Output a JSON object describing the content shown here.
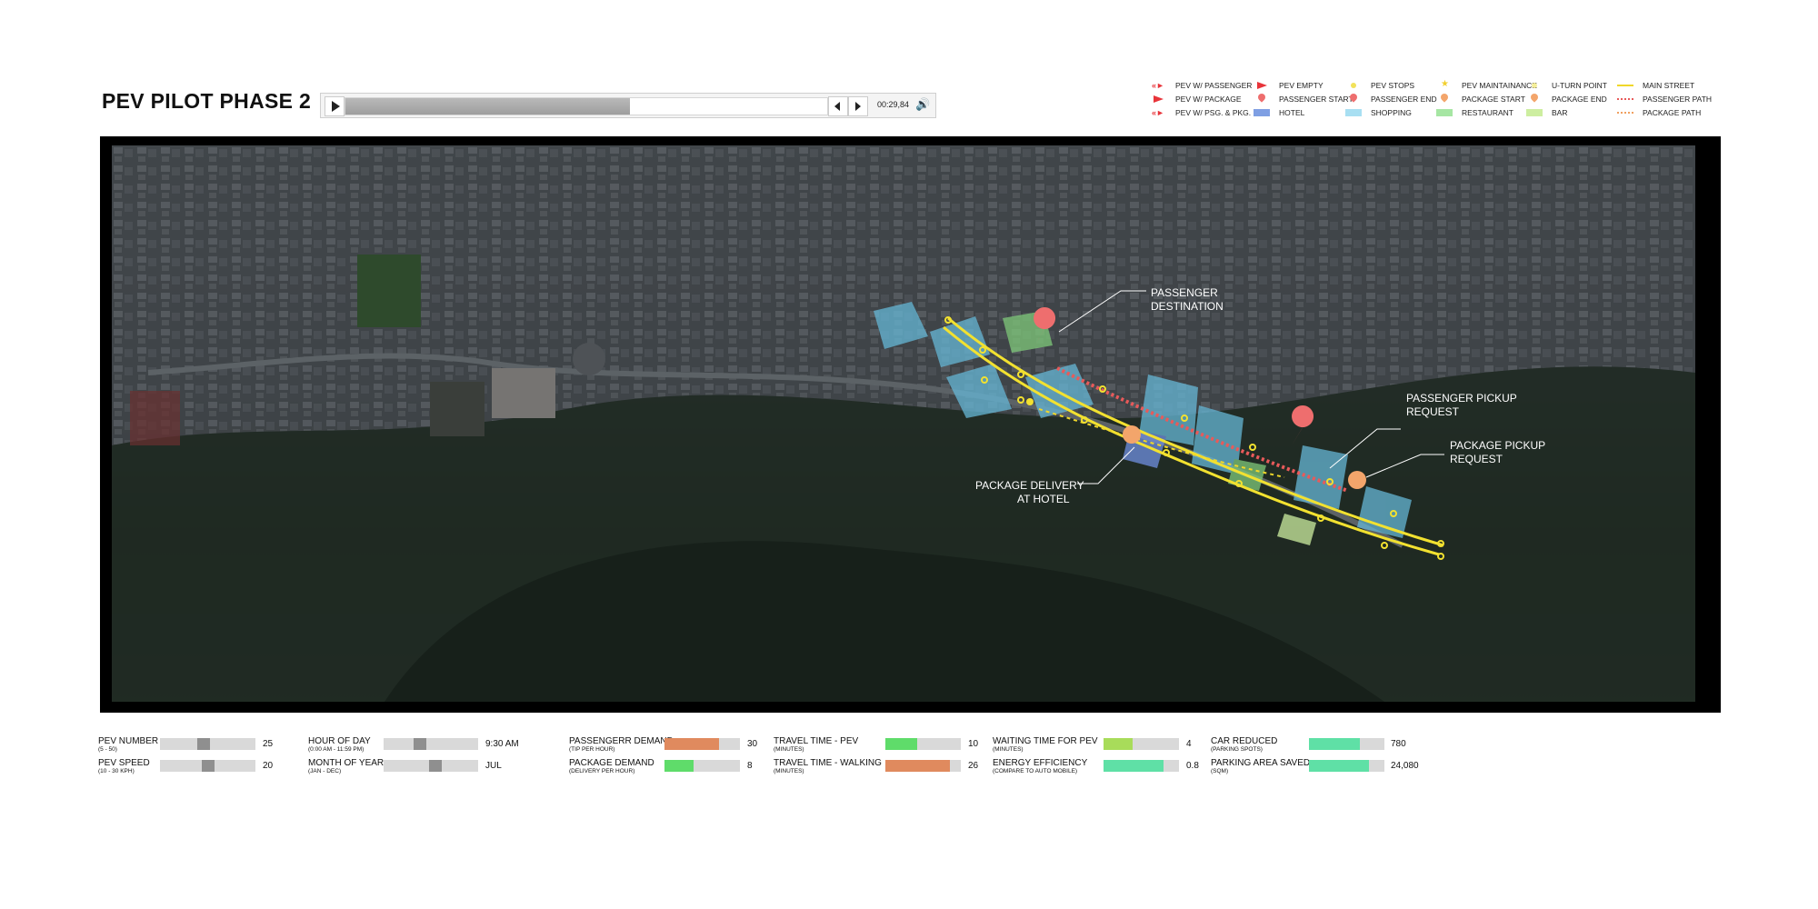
{
  "title": "PEV PILOT PHASE 2",
  "player": {
    "time": "00:29,84",
    "progress": 0.59,
    "play_icon": "play-icon",
    "volume_icon": "speaker-icon"
  },
  "legend": [
    {
      "label": "PEV W/ PASSENGER",
      "icon": "flag-arrows-icon",
      "color": "#e8343a"
    },
    {
      "label": "PEV EMPTY",
      "icon": "flag-icon",
      "color": "#e8343a"
    },
    {
      "label": "PEV STOPS",
      "icon": "dot-icon",
      "color": "#f2e25a"
    },
    {
      "label": "PEV MAINTAINANCE",
      "icon": "star-icon",
      "color": "#f2cf2e"
    },
    {
      "label": "U-TURN POINT",
      "icon": "dot-icon",
      "color": "#f4ee9a"
    },
    {
      "label": "MAIN STREET",
      "icon": "line-icon",
      "color": "#f0d72a"
    },
    {
      "label": "PEV W/ PACKAGE",
      "icon": "flag-icon",
      "color": "#e8343a"
    },
    {
      "label": "PASSENGER START",
      "icon": "pin-icon",
      "color": "#ee6e6e"
    },
    {
      "label": "PASSENGER END",
      "icon": "pin-icon",
      "color": "#ee6e6e"
    },
    {
      "label": "PACKAGE START",
      "icon": "pin-icon",
      "color": "#f3a56b"
    },
    {
      "label": "PACKAGE END",
      "icon": "pin-icon",
      "color": "#f3a56b"
    },
    {
      "label": "PASSENGER PATH",
      "icon": "dotted-line-icon",
      "color": "#e85a5a"
    },
    {
      "label": "PEV W/ PSG. & PKG.",
      "icon": "flag-arrows-icon",
      "color": "#e8343a"
    },
    {
      "label": "HOTEL",
      "icon": "swatch-icon",
      "color": "#7f9fe3"
    },
    {
      "label": "SHOPPING",
      "icon": "swatch-icon",
      "color": "#a8dff2"
    },
    {
      "label": "RESTAURANT",
      "icon": "swatch-icon",
      "color": "#a6e6a3"
    },
    {
      "label": "BAR",
      "icon": "swatch-icon",
      "color": "#cdeea0"
    },
    {
      "label": "PACKAGE PATH",
      "icon": "dotted-line-icon",
      "color": "#f0a060"
    }
  ],
  "map": {
    "annotations": {
      "passenger_destination": [
        "PASSENGER",
        "DESTINATION"
      ],
      "passenger_pickup": [
        "PASSENGER PICKUP",
        "REQUEST"
      ],
      "package_pickup": [
        "PACKAGE PICKUP",
        "REQUEST"
      ],
      "package_delivery": [
        "PACKAGE DELIVERY",
        "AT HOTEL"
      ]
    }
  },
  "sliders": [
    {
      "label": "PEV NUMBER",
      "sub": "(5 - 50)",
      "value": "25",
      "level": 0.45,
      "kind": "slider"
    },
    {
      "label": "PEV SPEED",
      "sub": "(10 - 30 KPH)",
      "value": "20",
      "level": 0.5,
      "kind": "slider"
    },
    {
      "label": "HOUR OF DAY",
      "sub": "(0:00 AM - 11:59 PM)",
      "value": "9:30 AM",
      "level": 0.37,
      "kind": "slider"
    },
    {
      "label": "MONTH OF YEAR",
      "sub": "(JAN - DEC)",
      "value": "JUL",
      "level": 0.55,
      "kind": "slider"
    }
  ],
  "metrics": [
    {
      "label": "PASSENGERR DEMAND",
      "sub": "(TIP PER HOUR)",
      "value": "30",
      "level": 0.72,
      "color": "#e08a5e"
    },
    {
      "label": "PACKAGE DEMAND",
      "sub": "(DELIVERY PER HOUR)",
      "value": "8",
      "level": 0.38,
      "color": "#5fdc6a"
    },
    {
      "label": "TRAVEL TIME - PEV",
      "sub": "(MINUTES)",
      "value": "10",
      "level": 0.42,
      "color": "#5fdc6a"
    },
    {
      "label": "TRAVEL TIME - WALKING",
      "sub": "(MINUTES)",
      "value": "26",
      "level": 0.85,
      "color": "#e08a5e"
    },
    {
      "label": "WAITING TIME FOR PEV",
      "sub": "(MINUTES)",
      "value": "4",
      "level": 0.38,
      "color": "#a8dc5a"
    },
    {
      "label": "ENERGY EFFICIENCY",
      "sub": "(COMPARE TO AUTO MOBILE)",
      "value": "0.8",
      "level": 0.8,
      "color": "#5fe0a6"
    },
    {
      "label": "CAR REDUCED",
      "sub": "(PARKING SPOTS)",
      "value": "780",
      "level": 0.68,
      "color": "#5fe0a6"
    },
    {
      "label": "PARKING AREA SAVED",
      "sub": "(SQM)",
      "value": "24,080",
      "level": 0.8,
      "color": "#5fe0a6"
    }
  ]
}
